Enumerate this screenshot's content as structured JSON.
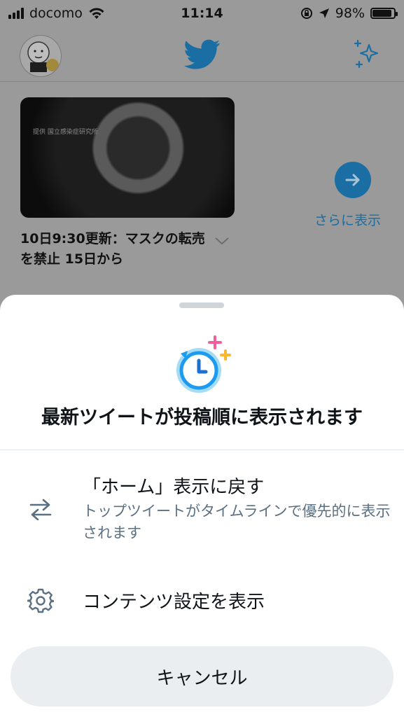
{
  "status_bar": {
    "carrier": "docomo",
    "time": "11:14",
    "battery": "98%",
    "battery_level": 0.98
  },
  "header": {
    "logo_icon": "twitter-bird-icon",
    "right_icon": "sparkle-icon",
    "accent_color": "#1da1f2"
  },
  "background": {
    "image_credit": "提供 国立感染症研究所",
    "headline": "10日9:30更新：マスクの転売を禁止 15日から",
    "more_label": "さらに表示"
  },
  "sheet": {
    "title": "最新ツイートが投稿順に表示されます",
    "options": [
      {
        "icon": "swap-arrows-icon",
        "label": "「ホーム」表示に戻す",
        "description": "トップツイートがタイムラインで優先的に表示されます"
      },
      {
        "icon": "gear-icon",
        "label": "コンテンツ設定を表示"
      }
    ],
    "cancel_label": "キャンセル"
  }
}
